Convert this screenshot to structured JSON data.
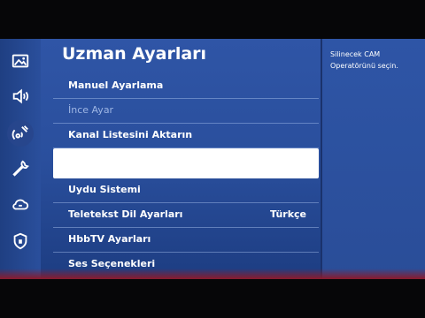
{
  "panel": {
    "title": "Uzman Ayarları",
    "items": [
      {
        "label": "Manuel Ayarlama",
        "value": "",
        "state": "normal"
      },
      {
        "label": "İnce Ayar",
        "value": "",
        "state": "disabled"
      },
      {
        "label": "Kanal Listesini Aktarın",
        "value": "",
        "state": "normal"
      },
      {
        "label": "",
        "value": "",
        "state": "selected"
      },
      {
        "label": "Uydu Sistemi",
        "value": "",
        "state": "normal"
      },
      {
        "label": "Teletekst Dil Ayarları",
        "value": "Türkçe",
        "state": "normal"
      },
      {
        "label": "HbbTV Ayarları",
        "value": "",
        "state": "normal"
      },
      {
        "label": "Ses Seçenekleri",
        "value": "",
        "state": "cut-off"
      }
    ]
  },
  "help": {
    "text": "Silinecek CAM Operatörünü seçin."
  },
  "sidebar": {
    "icons": [
      "picture-icon",
      "sound-icon",
      "broadcasting-icon",
      "general-wrench-icon",
      "support-cloud-icon",
      "shield-icon"
    ],
    "active_index": 2
  },
  "colors": {
    "background": "#2a4f9d",
    "selected_row": "#ffffff",
    "text": "#ffffff",
    "disabled_text": "#9eb6e4"
  }
}
